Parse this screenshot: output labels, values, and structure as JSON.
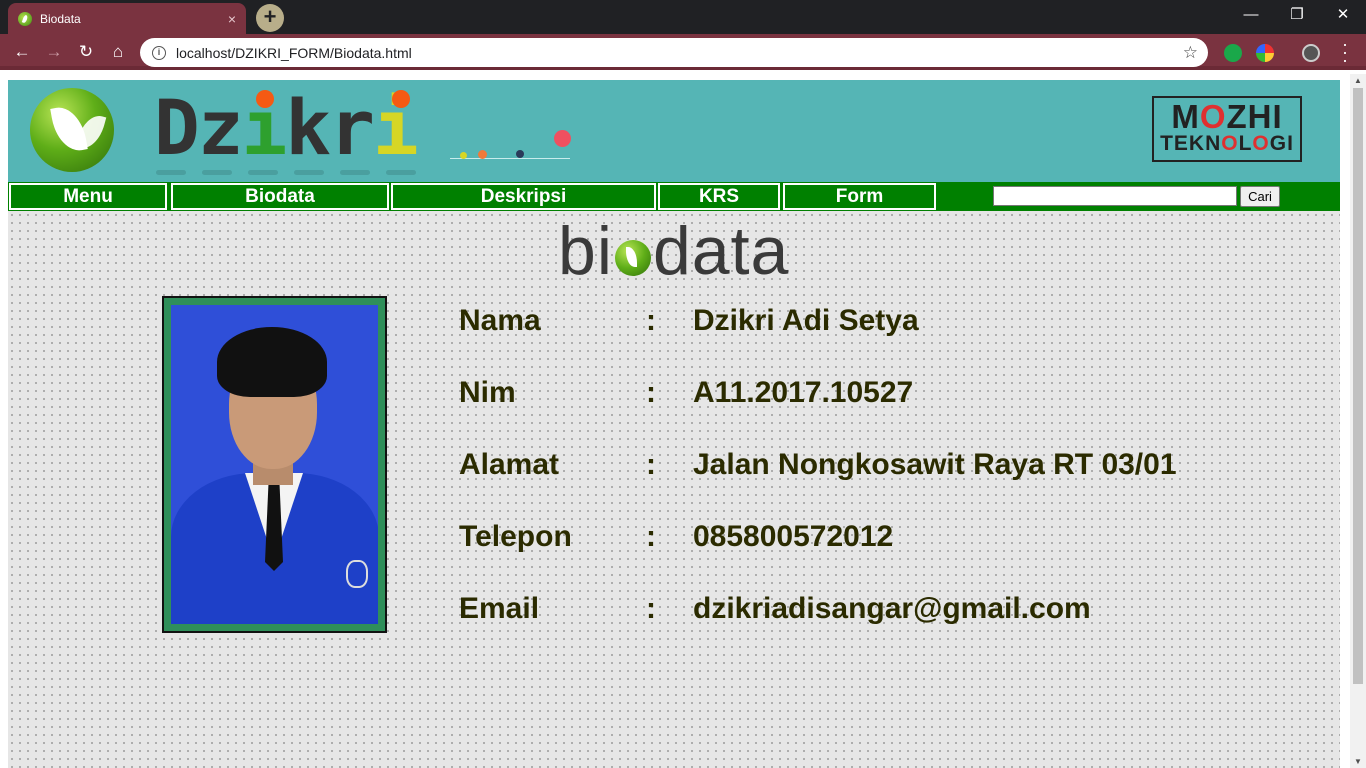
{
  "browser": {
    "tab_title": "Biodata",
    "tab_close": "×",
    "new_tab": "+",
    "url": "localhost/DZIKRI_FORM/Biodata.html",
    "window_controls": [
      "—",
      "❐",
      "✕"
    ]
  },
  "header": {
    "brand_letters": [
      "D",
      "z",
      "i",
      "k",
      "r",
      "i"
    ],
    "sponsor_line1_a": "M",
    "sponsor_line1_b": "O",
    "sponsor_line1_c": "ZHI",
    "sponsor_line2_a": "TEKN",
    "sponsor_line2_b": "O",
    "sponsor_line2_c": "L",
    "sponsor_line2_d": "O",
    "sponsor_line2_e": "GI"
  },
  "nav": {
    "items": [
      "Menu",
      "Biodata",
      "Deskripsi",
      "KRS",
      "Form"
    ],
    "search_value": "",
    "search_button": "Cari"
  },
  "page": {
    "title_a": "bi",
    "title_b": "data",
    "separator": ":",
    "fields": [
      {
        "label": "Nama",
        "value": "Dzikri Adi Setya"
      },
      {
        "label": "Nim",
        "value": "A11.2017.10527"
      },
      {
        "label": "Alamat",
        "value": "Jalan Nongkosawit Raya RT 03/01"
      },
      {
        "label": "Telepon",
        "value": "085800572012"
      },
      {
        "label": "Email",
        "value": "dzikriadisangar@gmail.com"
      }
    ]
  },
  "colors": {
    "header_bg": "#55b5b5",
    "nav_bg": "#008000",
    "tab_bg": "#7a3340",
    "text": "#2b2b00"
  }
}
